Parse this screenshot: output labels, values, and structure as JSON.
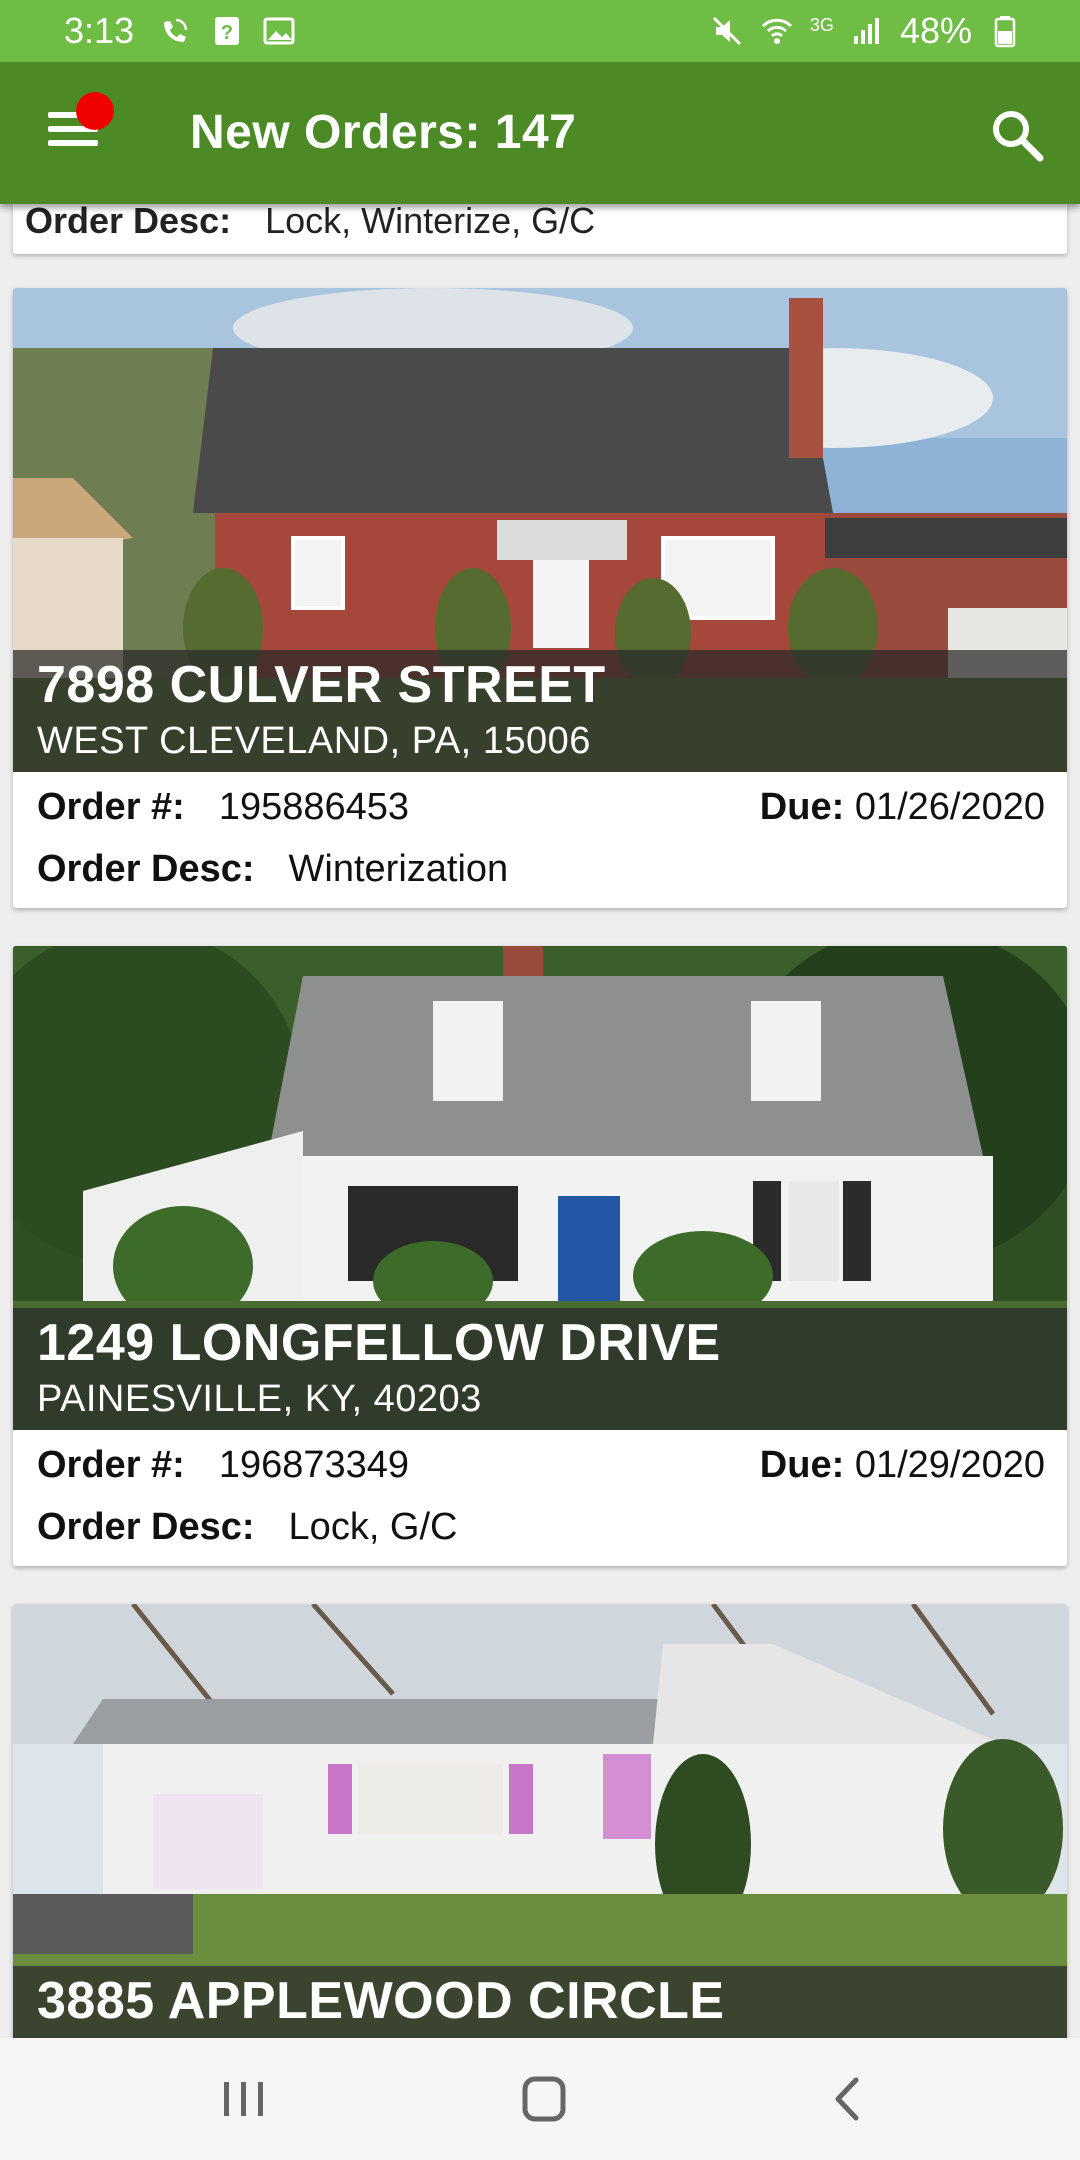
{
  "status_bar": {
    "time": "3:13",
    "battery": "48%",
    "network": "3G",
    "icons_left": [
      "wifi-call-icon",
      "question-box-icon",
      "image-icon"
    ],
    "icons_right": [
      "mute-icon",
      "wifi-icon",
      "signal-icon",
      "battery-icon"
    ]
  },
  "app_bar": {
    "title": "New Orders: 147",
    "menu_icon": "hamburger-menu-icon",
    "search_icon": "search-icon",
    "notification_dot_color": "#f00000"
  },
  "colors": {
    "status_bar": "#6fbd45",
    "app_bar": "#4b8a25"
  },
  "labels": {
    "order_no": "Order #:",
    "due": "Due:",
    "order_desc": "Order Desc:"
  },
  "partial_card": {
    "order_desc": "Lock, Winterize, G/C"
  },
  "orders": [
    {
      "street": "7898 CULVER STREET",
      "city": "WEST CLEVELAND, PA, 15006",
      "order_no": "195886453",
      "due": "01/26/2020",
      "desc": "Winterization"
    },
    {
      "street": "1249 LONGFELLOW DRIVE",
      "city": "PAINESVILLE, KY, 40203",
      "order_no": "196873349",
      "due": "01/29/2020",
      "desc": "Lock, G/C"
    },
    {
      "street": "3885 APPLEWOOD CIRCLE"
    }
  ],
  "nav_bar": {
    "buttons": [
      "recent-apps-icon",
      "home-icon",
      "back-icon"
    ]
  }
}
